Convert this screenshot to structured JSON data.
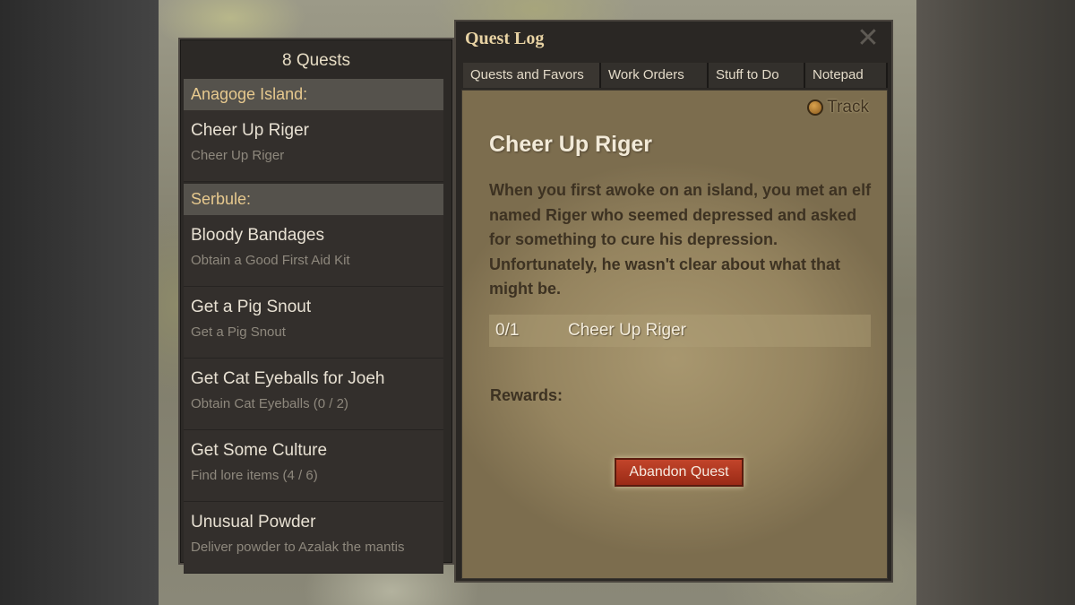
{
  "quest_list": {
    "header": "8 Quests",
    "groups": [
      {
        "name": "Anagoge Island:",
        "quests": [
          {
            "title": "Cheer Up Riger",
            "subtitle": "Cheer Up Riger"
          }
        ]
      },
      {
        "name": "Serbule:",
        "quests": [
          {
            "title": "Bloody Bandages",
            "subtitle": "Obtain a Good First Aid Kit"
          },
          {
            "title": "Get a Pig Snout",
            "subtitle": "Get a Pig Snout"
          },
          {
            "title": "Get Cat Eyeballs for Joeh",
            "subtitle": "Obtain Cat Eyeballs (0 / 2)"
          },
          {
            "title": "Get Some Culture",
            "subtitle": "Find lore items (4 / 6)"
          },
          {
            "title": "Unusual Powder",
            "subtitle": "Deliver powder to Azalak the mantis"
          }
        ]
      }
    ]
  },
  "quest_log": {
    "window_title": "Quest Log",
    "close_glyph": "✕",
    "tabs": [
      "Quests and Favors",
      "Work Orders",
      "Stuff to Do",
      "Notepad"
    ],
    "track_label": "Track",
    "quest_title": "Cheer Up Riger",
    "description": "When you first awoke on an island, you met an elf named Riger who seemed depressed and asked for something to cure his depression. Unfortunately, he wasn't clear about what that might be.",
    "objective": {
      "count": "0/1",
      "name": "Cheer Up Riger"
    },
    "rewards_label": "Rewards:",
    "abandon_label": "Abandon Quest"
  }
}
